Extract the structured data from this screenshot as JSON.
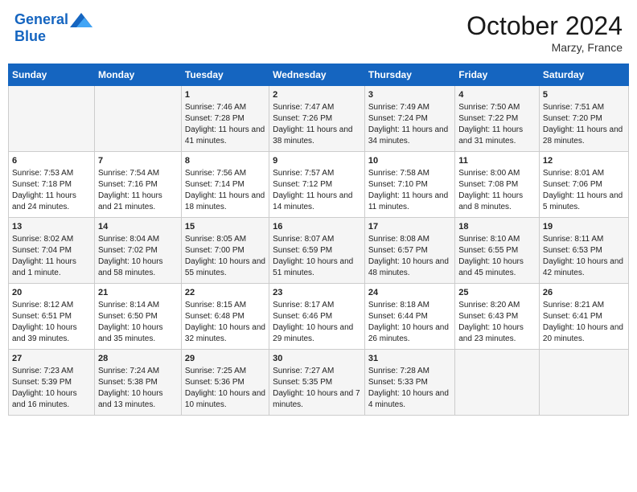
{
  "header": {
    "logo_line1": "General",
    "logo_line2": "Blue",
    "month_title": "October 2024",
    "location": "Marzy, France"
  },
  "days_of_week": [
    "Sunday",
    "Monday",
    "Tuesday",
    "Wednesday",
    "Thursday",
    "Friday",
    "Saturday"
  ],
  "weeks": [
    [
      {
        "day": "",
        "content": ""
      },
      {
        "day": "",
        "content": ""
      },
      {
        "day": "1",
        "content": "Sunrise: 7:46 AM\nSunset: 7:28 PM\nDaylight: 11 hours and 41 minutes."
      },
      {
        "day": "2",
        "content": "Sunrise: 7:47 AM\nSunset: 7:26 PM\nDaylight: 11 hours and 38 minutes."
      },
      {
        "day": "3",
        "content": "Sunrise: 7:49 AM\nSunset: 7:24 PM\nDaylight: 11 hours and 34 minutes."
      },
      {
        "day": "4",
        "content": "Sunrise: 7:50 AM\nSunset: 7:22 PM\nDaylight: 11 hours and 31 minutes."
      },
      {
        "day": "5",
        "content": "Sunrise: 7:51 AM\nSunset: 7:20 PM\nDaylight: 11 hours and 28 minutes."
      }
    ],
    [
      {
        "day": "6",
        "content": "Sunrise: 7:53 AM\nSunset: 7:18 PM\nDaylight: 11 hours and 24 minutes."
      },
      {
        "day": "7",
        "content": "Sunrise: 7:54 AM\nSunset: 7:16 PM\nDaylight: 11 hours and 21 minutes."
      },
      {
        "day": "8",
        "content": "Sunrise: 7:56 AM\nSunset: 7:14 PM\nDaylight: 11 hours and 18 minutes."
      },
      {
        "day": "9",
        "content": "Sunrise: 7:57 AM\nSunset: 7:12 PM\nDaylight: 11 hours and 14 minutes."
      },
      {
        "day": "10",
        "content": "Sunrise: 7:58 AM\nSunset: 7:10 PM\nDaylight: 11 hours and 11 minutes."
      },
      {
        "day": "11",
        "content": "Sunrise: 8:00 AM\nSunset: 7:08 PM\nDaylight: 11 hours and 8 minutes."
      },
      {
        "day": "12",
        "content": "Sunrise: 8:01 AM\nSunset: 7:06 PM\nDaylight: 11 hours and 5 minutes."
      }
    ],
    [
      {
        "day": "13",
        "content": "Sunrise: 8:02 AM\nSunset: 7:04 PM\nDaylight: 11 hours and 1 minute."
      },
      {
        "day": "14",
        "content": "Sunrise: 8:04 AM\nSunset: 7:02 PM\nDaylight: 10 hours and 58 minutes."
      },
      {
        "day": "15",
        "content": "Sunrise: 8:05 AM\nSunset: 7:00 PM\nDaylight: 10 hours and 55 minutes."
      },
      {
        "day": "16",
        "content": "Sunrise: 8:07 AM\nSunset: 6:59 PM\nDaylight: 10 hours and 51 minutes."
      },
      {
        "day": "17",
        "content": "Sunrise: 8:08 AM\nSunset: 6:57 PM\nDaylight: 10 hours and 48 minutes."
      },
      {
        "day": "18",
        "content": "Sunrise: 8:10 AM\nSunset: 6:55 PM\nDaylight: 10 hours and 45 minutes."
      },
      {
        "day": "19",
        "content": "Sunrise: 8:11 AM\nSunset: 6:53 PM\nDaylight: 10 hours and 42 minutes."
      }
    ],
    [
      {
        "day": "20",
        "content": "Sunrise: 8:12 AM\nSunset: 6:51 PM\nDaylight: 10 hours and 39 minutes."
      },
      {
        "day": "21",
        "content": "Sunrise: 8:14 AM\nSunset: 6:50 PM\nDaylight: 10 hours and 35 minutes."
      },
      {
        "day": "22",
        "content": "Sunrise: 8:15 AM\nSunset: 6:48 PM\nDaylight: 10 hours and 32 minutes."
      },
      {
        "day": "23",
        "content": "Sunrise: 8:17 AM\nSunset: 6:46 PM\nDaylight: 10 hours and 29 minutes."
      },
      {
        "day": "24",
        "content": "Sunrise: 8:18 AM\nSunset: 6:44 PM\nDaylight: 10 hours and 26 minutes."
      },
      {
        "day": "25",
        "content": "Sunrise: 8:20 AM\nSunset: 6:43 PM\nDaylight: 10 hours and 23 minutes."
      },
      {
        "day": "26",
        "content": "Sunrise: 8:21 AM\nSunset: 6:41 PM\nDaylight: 10 hours and 20 minutes."
      }
    ],
    [
      {
        "day": "27",
        "content": "Sunrise: 7:23 AM\nSunset: 5:39 PM\nDaylight: 10 hours and 16 minutes."
      },
      {
        "day": "28",
        "content": "Sunrise: 7:24 AM\nSunset: 5:38 PM\nDaylight: 10 hours and 13 minutes."
      },
      {
        "day": "29",
        "content": "Sunrise: 7:25 AM\nSunset: 5:36 PM\nDaylight: 10 hours and 10 minutes."
      },
      {
        "day": "30",
        "content": "Sunrise: 7:27 AM\nSunset: 5:35 PM\nDaylight: 10 hours and 7 minutes."
      },
      {
        "day": "31",
        "content": "Sunrise: 7:28 AM\nSunset: 5:33 PM\nDaylight: 10 hours and 4 minutes."
      },
      {
        "day": "",
        "content": ""
      },
      {
        "day": "",
        "content": ""
      }
    ]
  ]
}
